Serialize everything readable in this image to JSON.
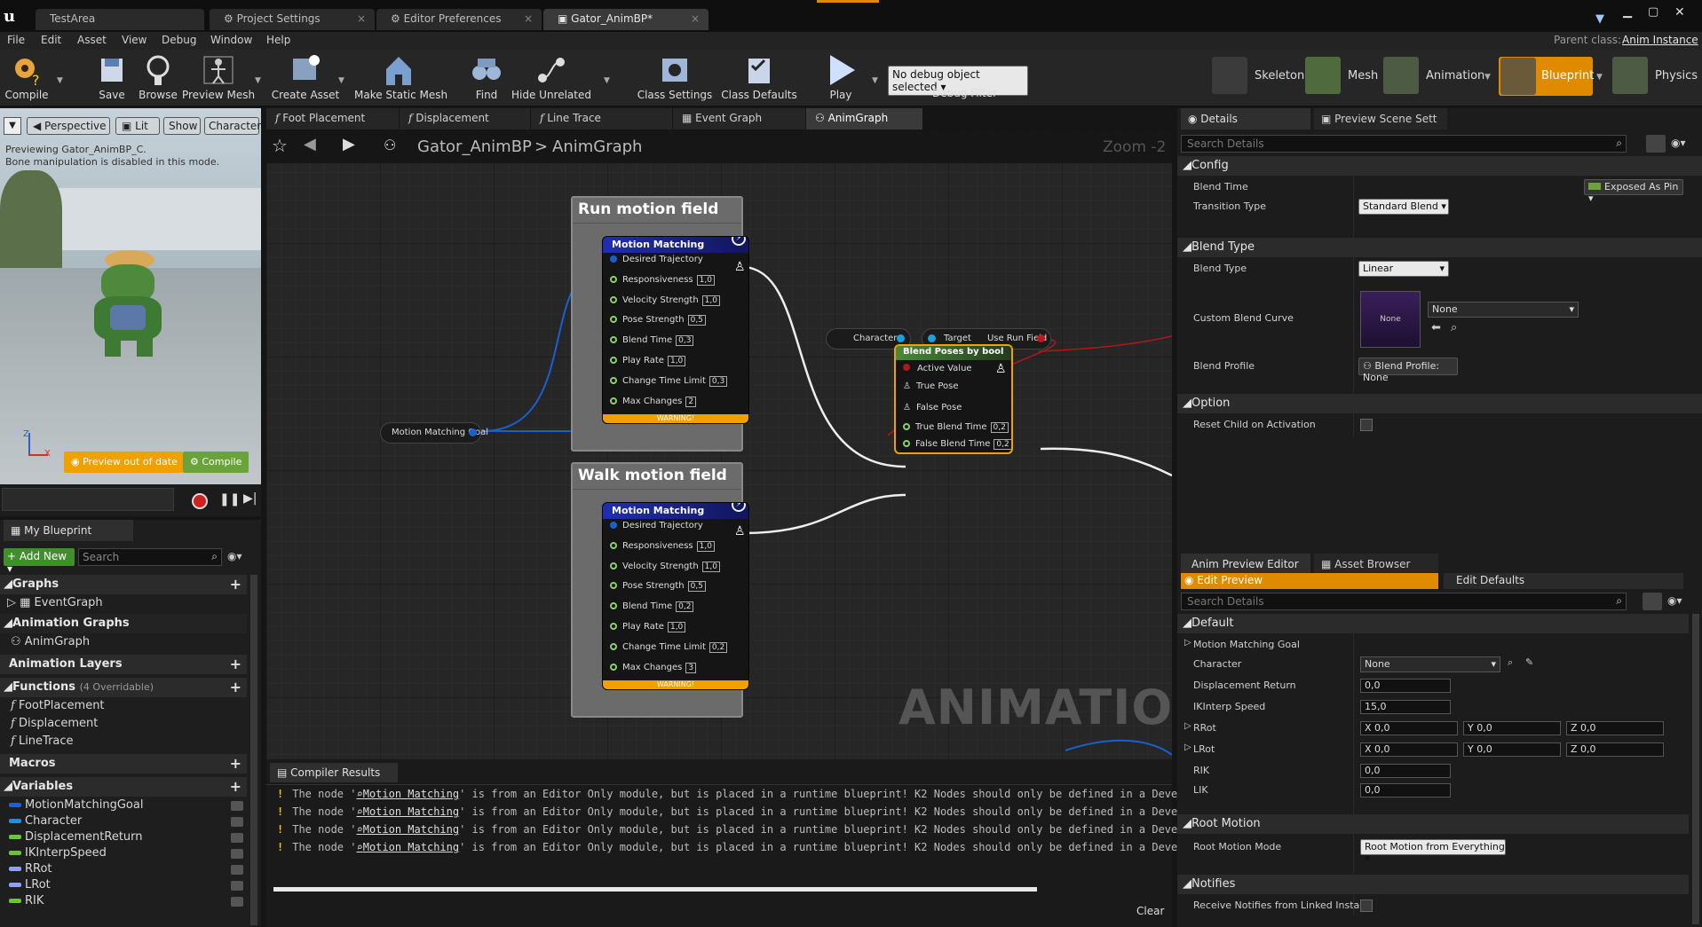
{
  "window": {
    "tabs": [
      {
        "label": "TestArea"
      },
      {
        "label": "Project Settings"
      },
      {
        "label": "Editor Preferences"
      },
      {
        "label": "Gator_AnimBP*"
      }
    ]
  },
  "menu": [
    "File",
    "Edit",
    "Asset",
    "View",
    "Debug",
    "Window",
    "Help"
  ],
  "parent_class": {
    "label": "Parent class:",
    "value": "Anim Instance"
  },
  "toolbar": {
    "compile": "Compile",
    "save": "Save",
    "browse": "Browse",
    "preview_mesh": "Preview Mesh",
    "create_asset": "Create Asset",
    "make_static_mesh": "Make Static Mesh",
    "find": "Find",
    "hide_unrelated": "Hide Unrelated",
    "class_settings": "Class Settings",
    "class_defaults": "Class Defaults",
    "play": "Play",
    "debug_select": "No debug object selected",
    "debug_filter": "Debug Filter"
  },
  "modes": {
    "skeleton": "Skeleton",
    "mesh": "Mesh",
    "animation": "Animation",
    "blueprint": "Blueprint",
    "physics": "Physics"
  },
  "viewport": {
    "perspective": "Perspective",
    "lit": "Lit",
    "show": "Show",
    "character": "Character",
    "preview_line1": "Previewing Gator_AnimBP_C.",
    "preview_line2": "Bone manipulation is disabled in this mode.",
    "out_of_date": "Preview out of date",
    "compile": "Compile"
  },
  "my_blueprint": {
    "tab": "My Blueprint",
    "add_new": "+ Add New",
    "search_placeholder": "Search",
    "graphs": "Graphs",
    "event_graph": "EventGraph",
    "animation_graphs": "Animation Graphs",
    "anim_graph": "AnimGraph",
    "animation_layers": "Animation Layers",
    "functions": "Functions",
    "functions_note": "(4 Overridable)",
    "function_items": [
      "FootPlacement",
      "Displacement",
      "LineTrace"
    ],
    "macros": "Macros",
    "variables": "Variables",
    "variable_items": [
      {
        "name": "MotionMatchingGoal",
        "color": "#1f5fd1"
      },
      {
        "name": "Character",
        "color": "#1f8fe0"
      },
      {
        "name": "DisplacementReturn",
        "color": "#69c43a"
      },
      {
        "name": "IKInterpSpeed",
        "color": "#69c43a"
      },
      {
        "name": "RRot",
        "color": "#8fa0ff"
      },
      {
        "name": "LRot",
        "color": "#8fa0ff"
      },
      {
        "name": "RIK",
        "color": "#69c43a"
      }
    ]
  },
  "graph_tabs": [
    "Foot Placement",
    "Displacement",
    "Line Trace",
    "Event Graph",
    "AnimGraph"
  ],
  "breadcrumb": {
    "root": "Gator_AnimBP",
    "sep": ">",
    "current": "AnimGraph",
    "zoom": "Zoom -2"
  },
  "watermark": "ANIMATION",
  "graph": {
    "run_field": {
      "title": "Run motion field",
      "node_title": "Motion Matching",
      "pins": [
        {
          "label": "Desired Trajectory",
          "val": ""
        },
        {
          "label": "Responsiveness",
          "val": "1,0"
        },
        {
          "label": "Velocity Strength",
          "val": "1,0"
        },
        {
          "label": "Pose Strength",
          "val": "0,5"
        },
        {
          "label": "Blend Time",
          "val": "0,3"
        },
        {
          "label": "Play Rate",
          "val": "1,0"
        },
        {
          "label": "Change Time Limit",
          "val": "0,3"
        },
        {
          "label": "Max Changes",
          "val": "2"
        }
      ],
      "warning": "WARNING!"
    },
    "walk_field": {
      "title": "Walk motion field",
      "node_title": "Motion Matching",
      "pins": [
        {
          "label": "Desired Trajectory",
          "val": ""
        },
        {
          "label": "Responsiveness",
          "val": "1,0"
        },
        {
          "label": "Velocity Strength",
          "val": "1,0"
        },
        {
          "label": "Pose Strength",
          "val": "0,5"
        },
        {
          "label": "Blend Time",
          "val": "0,2"
        },
        {
          "label": "Play Rate",
          "val": "1,0"
        },
        {
          "label": "Change Time Limit",
          "val": "0,2"
        },
        {
          "label": "Max Changes",
          "val": "3"
        }
      ],
      "warning": "WARNING!"
    },
    "goal_pill": "Motion Matching Goal",
    "character_pill": "Character",
    "target": "Target",
    "use_run_field": "Use Run Field",
    "blend": {
      "title": "Blend Poses by bool",
      "active": "Active Value",
      "true_pose": "True Pose",
      "false_pose": "False Pose",
      "true_bt": "True Blend Time",
      "true_bt_val": "0,2",
      "false_bt": "False Blend Time",
      "false_bt_val": "0,2"
    }
  },
  "compiler": {
    "tab": "Compiler Results",
    "messages": [
      {
        "pre": "The node '",
        "link": "Motion Matching",
        "post": "' is from an Editor Only module, but is placed in a runtime blueprint! K2 Nodes should only be defined in a Develop"
      },
      {
        "pre": "The node '",
        "link": "Motion Matching",
        "post": "' is from an Editor Only module, but is placed in a runtime blueprint! K2 Nodes should only be defined in a Develop"
      },
      {
        "pre": "The node '",
        "link": "Motion Matching",
        "post": "' is from an Editor Only module, but is placed in a runtime blueprint! K2 Nodes should only be defined in a Develop"
      },
      {
        "pre": "The node '",
        "link": "Motion Matching",
        "post": "' is from an Editor Only module, but is placed in a runtime blueprint! K2 Nodes should only be defined in a Develop"
      }
    ],
    "clear": "Clear"
  },
  "details": {
    "tab": "Details",
    "tab2": "Preview Scene Sett",
    "search": "Search Details",
    "config": "Config",
    "blend_time": "Blend Time",
    "exposed": "Exposed As Pin",
    "transition_type": "Transition Type",
    "transition_val": "Standard Blend",
    "blend_type_sec": "Blend Type",
    "blend_type": "Blend Type",
    "blend_type_val": "Linear",
    "custom_curve": "Custom Blend Curve",
    "curve_none": "None",
    "curve_select": "None",
    "blend_profile": "Blend Profile",
    "blend_profile_val": "Blend Profile: None",
    "option": "Option",
    "reset_child": "Reset Child on Activation"
  },
  "anim_preview": {
    "tab": "Anim Preview Editor",
    "tab2": "Asset Browser",
    "edit_preview": "Edit Preview",
    "edit_defaults": "Edit Defaults",
    "search": "Search Details",
    "default": "Default",
    "mm_goal": "Motion Matching Goal",
    "character": "Character",
    "character_val": "None",
    "disp_return": "Displacement Return",
    "disp_val": "0,0",
    "ik_speed": "IKInterp Speed",
    "ik_val": "15,0",
    "rrot": "RRot",
    "rx": "0,0",
    "ry": "0,0",
    "rz": "0,0",
    "lrot": "LRot",
    "lx": "0,0",
    "ly": "0,0",
    "lz": "0,0",
    "rik": "RIK",
    "rik_val": "0,0",
    "lik": "LIK",
    "lik_val": "0,0",
    "root_motion": "Root Motion",
    "root_motion_mode": "Root Motion Mode",
    "root_motion_val": "Root Motion from Everything",
    "notifies": "Notifies",
    "receive_notifies": "Receive Notifies from Linked Instan"
  }
}
